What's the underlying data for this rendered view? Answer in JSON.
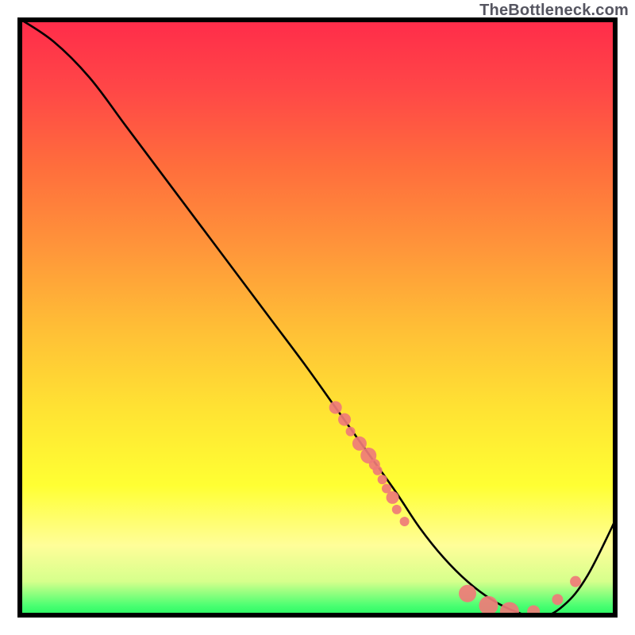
{
  "attribution": "TheBottleneck.com",
  "chart_data": {
    "type": "line",
    "title": "",
    "xlabel": "",
    "ylabel": "",
    "xlim": [
      0,
      100
    ],
    "ylim": [
      0,
      100
    ],
    "curve": {
      "x": [
        0,
        6,
        12,
        18,
        24,
        30,
        36,
        42,
        48,
        53,
        58,
        63,
        67,
        71,
        75,
        79,
        83,
        87,
        91,
        95,
        100
      ],
      "y": [
        100,
        96,
        90,
        82,
        74,
        66,
        58,
        50,
        42,
        35,
        28,
        21,
        15,
        10,
        6,
        3,
        1,
        0,
        2,
        7,
        17
      ]
    },
    "series": [
      {
        "name": "dots",
        "type": "scatter",
        "color": "#ef7b78",
        "points": [
          {
            "x": 53,
            "y": 35,
            "r": 8
          },
          {
            "x": 54.5,
            "y": 33,
            "r": 8
          },
          {
            "x": 55.5,
            "y": 31,
            "r": 6
          },
          {
            "x": 57,
            "y": 29,
            "r": 9
          },
          {
            "x": 58.5,
            "y": 27,
            "r": 10
          },
          {
            "x": 59.5,
            "y": 25.5,
            "r": 7
          },
          {
            "x": 60,
            "y": 24.5,
            "r": 6
          },
          {
            "x": 60.8,
            "y": 23,
            "r": 6
          },
          {
            "x": 61.5,
            "y": 21.5,
            "r": 6
          },
          {
            "x": 62.5,
            "y": 20,
            "r": 8
          },
          {
            "x": 63.2,
            "y": 18,
            "r": 6
          },
          {
            "x": 64.5,
            "y": 16,
            "r": 6
          },
          {
            "x": 75,
            "y": 4,
            "r": 11
          },
          {
            "x": 78.5,
            "y": 2,
            "r": 12
          },
          {
            "x": 82,
            "y": 1,
            "r": 12
          },
          {
            "x": 86,
            "y": 1,
            "r": 8
          },
          {
            "x": 90,
            "y": 3,
            "r": 7
          },
          {
            "x": 93,
            "y": 6,
            "r": 7
          }
        ]
      }
    ],
    "gradient_stops": [
      {
        "p": 0,
        "c": "#ff2b4a"
      },
      {
        "p": 12,
        "c": "#ff4747"
      },
      {
        "p": 25,
        "c": "#ff6e3c"
      },
      {
        "p": 38,
        "c": "#ff943a"
      },
      {
        "p": 52,
        "c": "#ffbf36"
      },
      {
        "p": 65,
        "c": "#ffe233"
      },
      {
        "p": 78,
        "c": "#ffff33"
      },
      {
        "p": 88,
        "c": "#fffe99"
      },
      {
        "p": 94,
        "c": "#d6ff8c"
      },
      {
        "p": 98,
        "c": "#4bff72"
      },
      {
        "p": 100,
        "c": "#1ff65f"
      }
    ]
  }
}
